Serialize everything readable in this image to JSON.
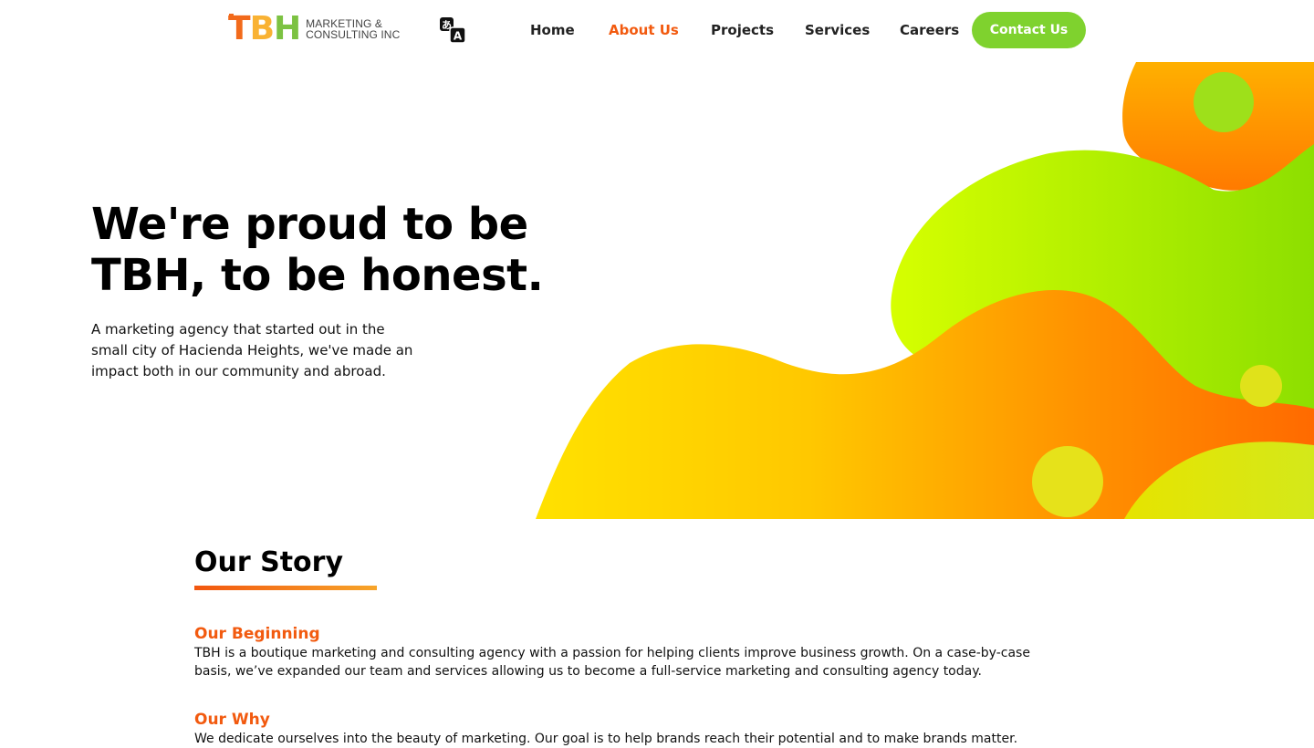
{
  "header": {
    "logo": {
      "mark": [
        "T",
        "B",
        "H"
      ],
      "text_line1": "MARKETING &",
      "text_line2": "CONSULTING INC"
    },
    "translate_icon": "translate-icon",
    "nav": [
      {
        "label": "Home",
        "active": false
      },
      {
        "label": "About Us",
        "active": true
      },
      {
        "label": "Projects",
        "active": false
      },
      {
        "label": "Services",
        "active": false
      },
      {
        "label": "Careers",
        "active": false
      }
    ],
    "cta_label": "Contact Us"
  },
  "hero": {
    "title_line1": "We're proud to be",
    "title_line2": "TBH, to be honest.",
    "subtitle_line1": "A marketing agency that started out in the",
    "subtitle_line2": "small city of Hacienda Heights, we've made an",
    "subtitle_line3": "impact both in our community and abroad."
  },
  "story": {
    "title": "Our Story",
    "sections": [
      {
        "heading": "Our Beginning",
        "line1": "TBH is a boutique marketing and consulting agency with a passion for helping clients improve business growth. On a case-by-case",
        "line2": "basis, we’ve expanded our team and services allowing us to become a full-service marketing and consulting agency today."
      },
      {
        "heading": "Our Why",
        "line1": "We dedicate ourselves into the beauty of marketing. Our goal is to help brands reach their potential and to make brands matter."
      }
    ]
  },
  "colors": {
    "accent_orange": "#f25a0f",
    "brand_green": "#7fd22e",
    "logo_t": "#f26a1b",
    "logo_b": "#f9b233",
    "logo_h": "#7cc242"
  }
}
